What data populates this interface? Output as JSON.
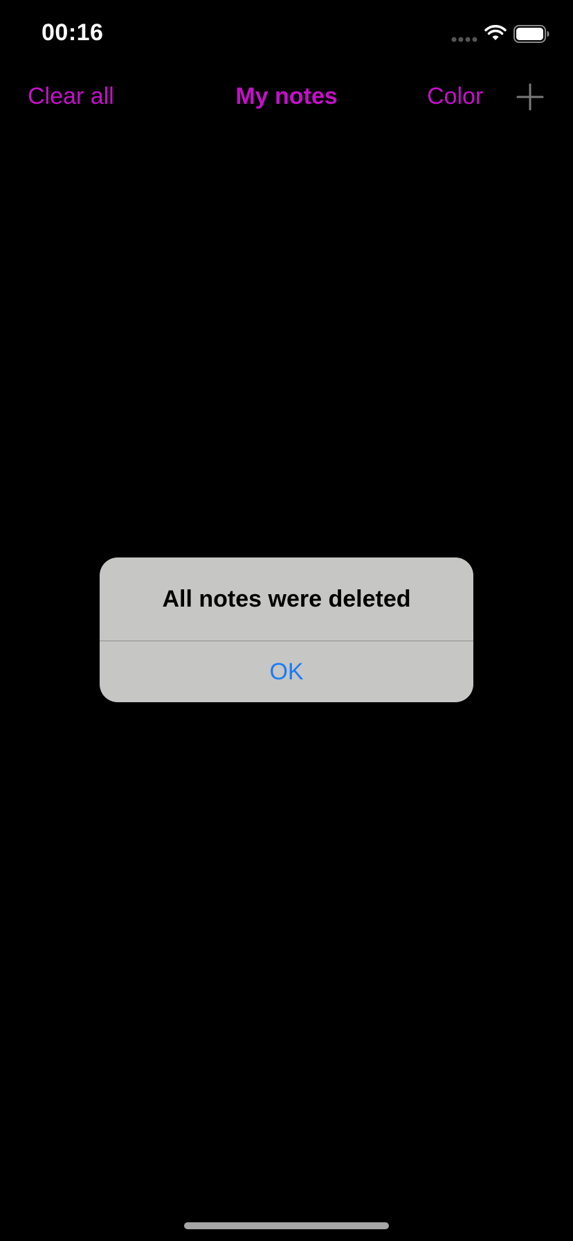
{
  "status_bar": {
    "time": "00:16",
    "icons": [
      "signal-icon",
      "wifi-icon",
      "battery-icon"
    ]
  },
  "nav": {
    "clear_label": "Clear all",
    "title": "My notes",
    "color_label": "Color",
    "add_icon": "plus-icon"
  },
  "alert": {
    "title": "All notes were deleted",
    "ok_label": "OK"
  },
  "colors": {
    "accent": "#c410c9",
    "background": "#000000",
    "alert_bg": "#c6c6c5",
    "alert_button": "#1a7cf5"
  }
}
